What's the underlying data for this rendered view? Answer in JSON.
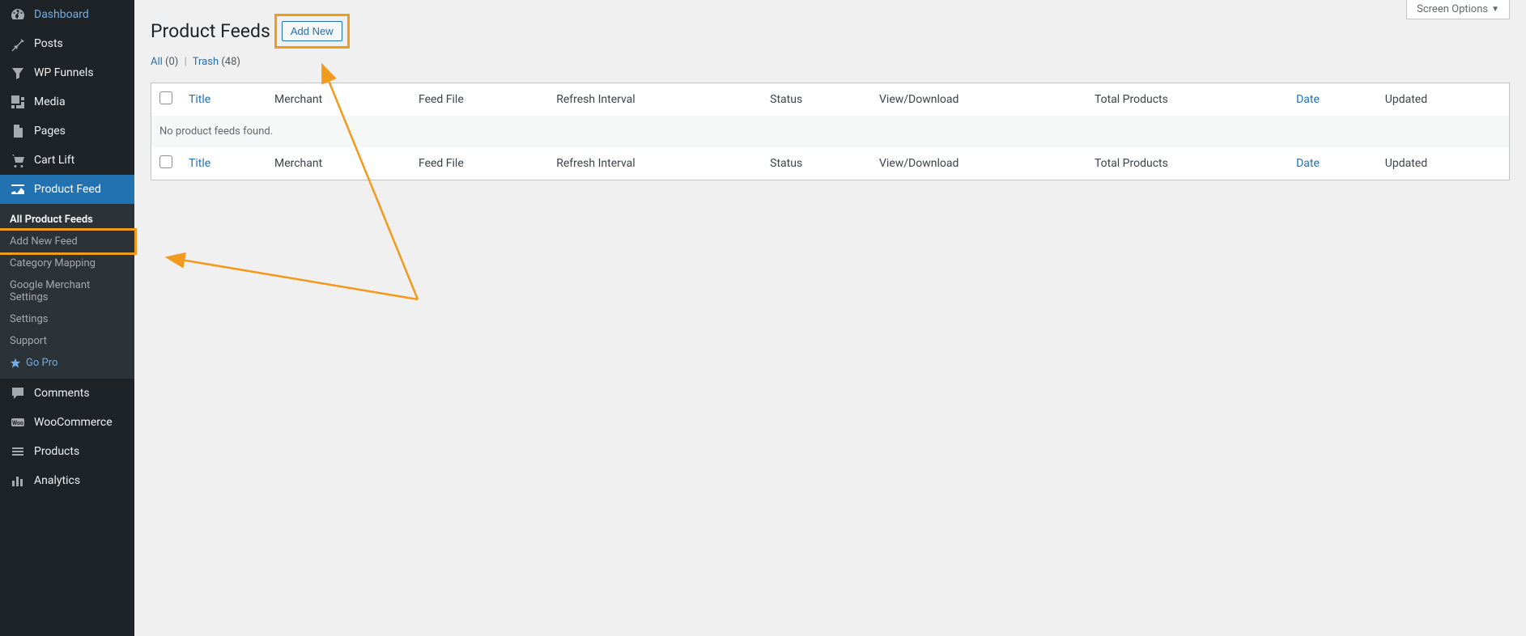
{
  "screen_options_label": "Screen Options",
  "page": {
    "title": "Product Feeds",
    "add_new_label": "Add New"
  },
  "filters": {
    "all_label": "All",
    "all_count": "(0)",
    "trash_label": "Trash",
    "trash_count": "(48)"
  },
  "table": {
    "headers": {
      "title": "Title",
      "merchant": "Merchant",
      "feed_file": "Feed File",
      "refresh_interval": "Refresh Interval",
      "status": "Status",
      "view_download": "View/Download",
      "total_products": "Total Products",
      "date": "Date",
      "updated": "Updated"
    },
    "empty_message": "No product feeds found."
  },
  "sidebar": {
    "dashboard": "Dashboard",
    "posts": "Posts",
    "wp_funnels": "WP Funnels",
    "media": "Media",
    "pages": "Pages",
    "cart_lift": "Cart Lift",
    "product_feed": "Product Feed",
    "comments": "Comments",
    "woocommerce": "WooCommerce",
    "products": "Products",
    "analytics": "Analytics"
  },
  "submenu": {
    "all_product_feeds": "All Product Feeds",
    "add_new_feed": "Add New Feed",
    "category_mapping": "Category Mapping",
    "google_merchant_settings": "Google Merchant Settings",
    "settings": "Settings",
    "support": "Support",
    "go_pro": "Go Pro"
  }
}
